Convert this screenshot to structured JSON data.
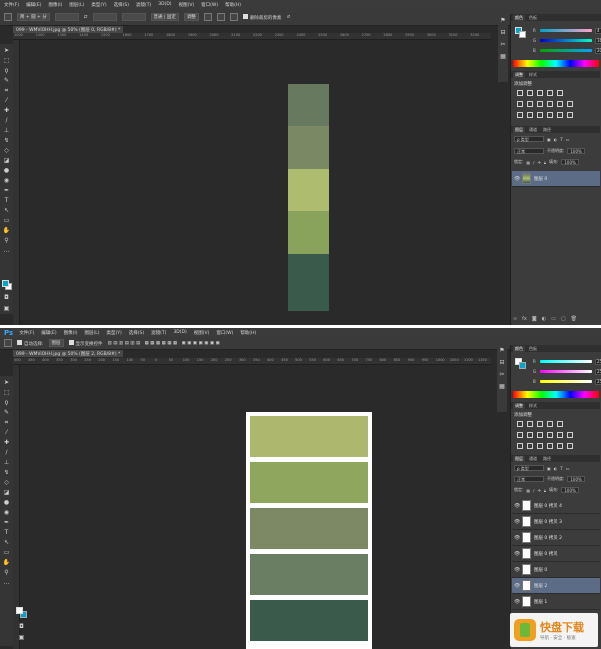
{
  "menu": [
    "文件(F)",
    "编辑(E)",
    "图像(I)",
    "图层(L)",
    "类型(Y)",
    "选择(S)",
    "滤镜(T)",
    "3D(D)",
    "视图(V)",
    "窗口(W)",
    "帮助(H)"
  ],
  "top": {
    "options": {
      "mode": "简 + 圆 + 分",
      "style": "普通 | 固定",
      "adjust": "调整",
      "sample_all": "删除裁剪的像素"
    },
    "doc_tab": "099 - WMViOHH.jpg @ 50% (图层 0, RGB/8#) *",
    "ruler": [
      "1000",
      "1200",
      "1300",
      "1400",
      "1500",
      "1600",
      "1700",
      "1800",
      "1900",
      "2000",
      "2100",
      "2200",
      "2300",
      "2400",
      "2500",
      "2600",
      "2700",
      "2800",
      "2900",
      "3000",
      "3100",
      "3200"
    ],
    "color_values": {
      "r": "4",
      "g": "163",
      "b": "202"
    },
    "adj_title": "添加调整",
    "panel_tabs_color": [
      "颜色",
      "色板"
    ],
    "panel_tabs_adj": [
      "调整",
      "样式"
    ],
    "panel_tabs_layers": [
      "图层",
      "通道",
      "路径"
    ],
    "blend_mode": "正常",
    "opacity_label": "不透明度:",
    "opacity": "100%",
    "fill_label": "填充:",
    "fill": "100%",
    "lock_label": "锁定:",
    "layers": [
      {
        "name": "图层 0",
        "selected": true
      }
    ],
    "swatches": [
      "#677a60",
      "#7a8863",
      "#adbc6f",
      "#8aa35c",
      "#3a5a4b"
    ]
  },
  "bottom": {
    "options": {
      "auto_select": "自动选择:",
      "target": "图层",
      "transform": "显示变换控件"
    },
    "doc_tab": "099 - WMViOHH.jpg @ 50% (图层 2, RGB/8#) *",
    "ruler": [
      "500",
      "450",
      "400",
      "350",
      "300",
      "250",
      "200",
      "150",
      "100",
      "50",
      "0",
      "50",
      "100",
      "150",
      "200",
      "250",
      "300",
      "350",
      "400",
      "450",
      "500",
      "550",
      "600",
      "650",
      "700",
      "750",
      "800",
      "850",
      "900",
      "950",
      "1000",
      "1050",
      "1100",
      "1150"
    ],
    "color_values": {
      "r": "255",
      "g": "255",
      "b": "255"
    },
    "adj_title": "添加调整",
    "panel_tabs_color": [
      "颜色",
      "色板"
    ],
    "panel_tabs_adj": [
      "调整",
      "样式"
    ],
    "panel_tabs_layers": [
      "图层",
      "通道",
      "路径"
    ],
    "blend_mode": "正常",
    "opacity_label": "不透明度:",
    "opacity": "100%",
    "fill_label": "填充:",
    "fill": "100%",
    "lock_label": "锁定:",
    "layers": [
      {
        "name": "图层 0 拷贝 4",
        "selected": false
      },
      {
        "name": "图层 0 拷贝 3",
        "selected": false
      },
      {
        "name": "图层 0 拷贝 2",
        "selected": false
      },
      {
        "name": "图层 0 拷贝",
        "selected": false
      },
      {
        "name": "图层 0",
        "selected": false
      },
      {
        "name": "图层 2",
        "selected": true
      },
      {
        "name": "图层 1",
        "selected": false
      }
    ],
    "swatches": [
      "#adb86e",
      "#8ea65e",
      "#7d8864",
      "#6a7e63",
      "#3a5a4c"
    ]
  },
  "watermark": {
    "title": "快盘下载",
    "subtitle": "导航 · 安全 · 极速"
  }
}
